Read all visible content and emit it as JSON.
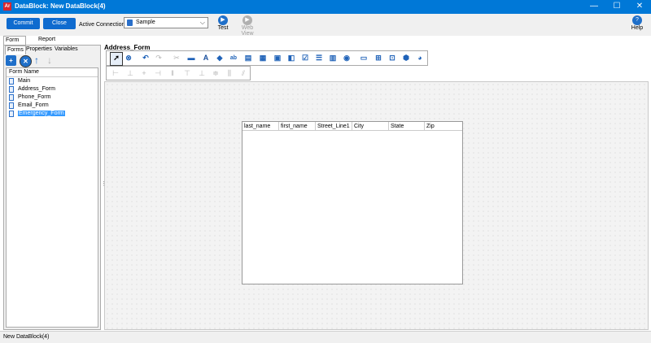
{
  "window": {
    "title": "DataBlock: New DataBlock(4)",
    "app_icon": "Ar",
    "minimize": "—",
    "maximize": "☐",
    "close": "✕"
  },
  "toolbar": {
    "commit_label": "Commit",
    "close_label": "Close",
    "active_connection_label": "Active Connection",
    "connection_value": "Sample",
    "test_label": "Test",
    "web_view_label": "Web View",
    "help_label": "Help"
  },
  "tabs": [
    "Form Design",
    "Report Query - Visual Design"
  ],
  "left_tabs": [
    "Forms",
    "Properties",
    "Variables"
  ],
  "forms": {
    "header": "Form Name",
    "items": [
      "Main",
      "Address_Form",
      "Phone_Form",
      "Email_Form",
      "Emergency_Form"
    ],
    "selected_index": 4
  },
  "design": {
    "title": "Address_Form",
    "grid_columns": [
      "last_name",
      "first_name",
      "Street_Line1",
      "City",
      "State",
      "Zip"
    ]
  },
  "status": {
    "text": "New DataBlock(4)"
  },
  "colors": {
    "accent": "#0078d7",
    "button": "#0f6bcf",
    "selected": "#3399ff"
  }
}
